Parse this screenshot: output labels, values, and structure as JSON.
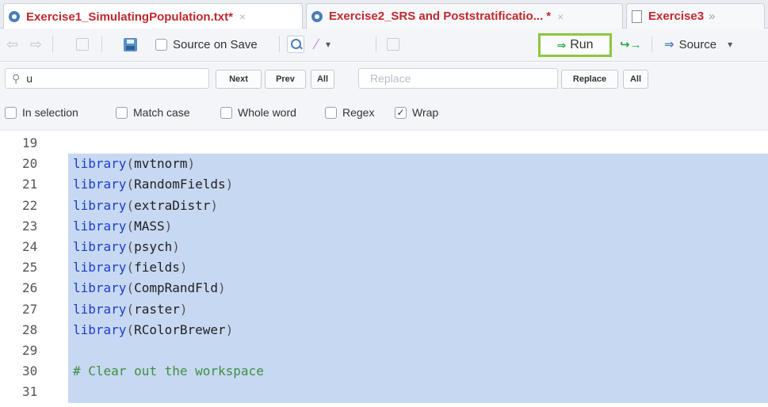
{
  "tabs": [
    {
      "label": "Exercise1_SimulatingPopulation.txt*",
      "close": "×",
      "active": true
    },
    {
      "label": "Exercise2_SRS and Poststratificatio... *",
      "close": "×",
      "active": false
    },
    {
      "label": "Exercise3",
      "more": "»",
      "active": false
    }
  ],
  "toolbar": {
    "source_on_save_label": "Source on Save",
    "run_label": "Run",
    "source_label": "Source",
    "dropdown_caret": "▾"
  },
  "find": {
    "value": "u",
    "next_label": "Next",
    "prev_label": "Prev",
    "all_label": "All",
    "replace_placeholder": "Replace",
    "replace_label": "Replace",
    "replace_all_label": "All",
    "options": [
      {
        "label": "In selection",
        "checked": false
      },
      {
        "label": "Match case",
        "checked": false
      },
      {
        "label": "Whole word",
        "checked": false
      },
      {
        "label": "Regex",
        "checked": false
      },
      {
        "label": "Wrap",
        "checked": true
      }
    ]
  },
  "editor": {
    "lines": [
      {
        "num": "19",
        "fn": "",
        "arg": "",
        "comment": "",
        "selected": false
      },
      {
        "num": "20",
        "fn": "library",
        "arg": "mvtnorm",
        "comment": "",
        "selected": true
      },
      {
        "num": "21",
        "fn": "library",
        "arg": "RandomFields",
        "comment": "",
        "selected": true
      },
      {
        "num": "22",
        "fn": "library",
        "arg": "extraDistr",
        "comment": "",
        "selected": true
      },
      {
        "num": "23",
        "fn": "library",
        "arg": "MASS",
        "comment": "",
        "selected": true
      },
      {
        "num": "24",
        "fn": "library",
        "arg": "psych",
        "comment": "",
        "selected": true
      },
      {
        "num": "25",
        "fn": "library",
        "arg": "fields",
        "comment": "",
        "selected": true
      },
      {
        "num": "26",
        "fn": "library",
        "arg": "CompRandFld",
        "comment": "",
        "selected": true
      },
      {
        "num": "27",
        "fn": "library",
        "arg": "raster",
        "comment": "",
        "selected": true
      },
      {
        "num": "28",
        "fn": "library",
        "arg": "RColorBrewer",
        "comment": "",
        "selected": true
      },
      {
        "num": "29",
        "fn": "",
        "arg": "",
        "comment": "",
        "selected": true
      },
      {
        "num": "30",
        "fn": "",
        "arg": "",
        "comment": "# Clear out the workspace",
        "selected": true
      },
      {
        "num": "31",
        "fn": "",
        "arg": "",
        "comment": "",
        "selected": true
      }
    ]
  }
}
